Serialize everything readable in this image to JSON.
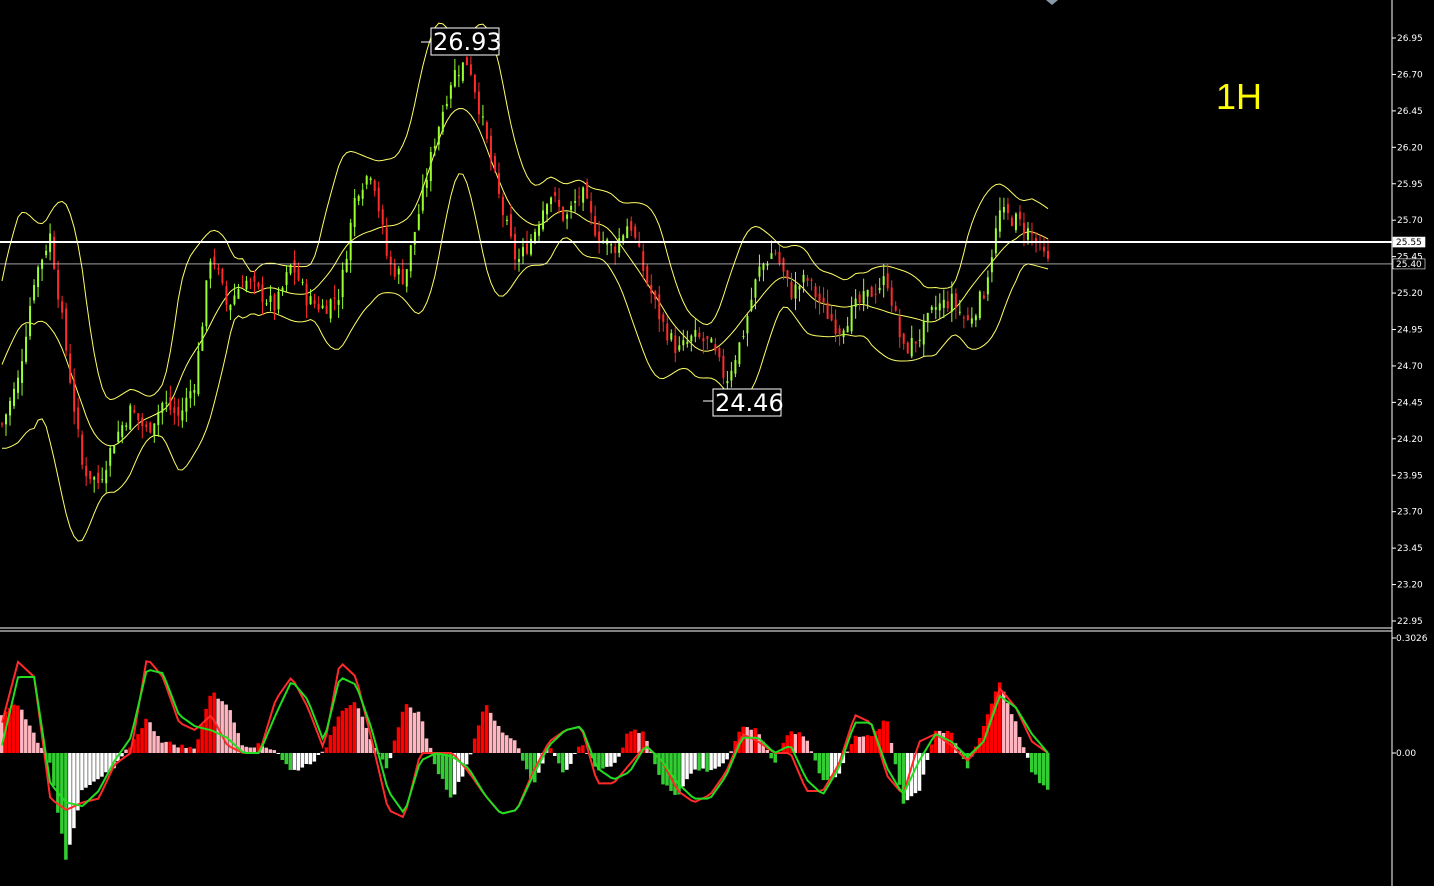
{
  "timeframe": "1H",
  "chart_data": [
    {
      "type": "candlestick",
      "title": "",
      "ylim": [
        22.9,
        27.1
      ],
      "y_ticks": [
        "26.95",
        "26.70",
        "26.45",
        "26.20",
        "25.95",
        "25.70",
        "25.45",
        "25.20",
        "24.95",
        "24.70",
        "24.45",
        "24.20",
        "23.95",
        "23.70",
        "23.45",
        "23.20",
        "22.95"
      ],
      "price_tags": [
        {
          "label": "25.55",
          "value": 25.55
        },
        {
          "label": "25.40",
          "value": 25.4
        }
      ],
      "annotations": [
        {
          "label": "26.93",
          "value": 26.93,
          "kind": "high"
        },
        {
          "label": "24.46",
          "value": 24.46,
          "kind": "low"
        }
      ],
      "colors": {
        "up": "#99ff33",
        "down": "#ff2a2a",
        "band": "#ffff66",
        "hline": "#ffffff"
      },
      "close_path": [
        24.3,
        24.6,
        25.3,
        25.6,
        24.8,
        24.0,
        23.9,
        24.2,
        24.4,
        24.25,
        24.45,
        24.35,
        24.6,
        25.5,
        25.1,
        25.3,
        25.2,
        25.1,
        25.4,
        25.15,
        25.1,
        25.2,
        25.9,
        26.05,
        25.4,
        25.3,
        25.8,
        26.3,
        26.7,
        26.8,
        26.3,
        25.8,
        25.4,
        25.6,
        25.9,
        25.7,
        25.9,
        25.6,
        25.5,
        25.7,
        25.3,
        25.0,
        24.8,
        24.9,
        24.85,
        24.6,
        24.9,
        25.35,
        25.5,
        25.2,
        25.3,
        25.1,
        24.95,
        25.1,
        25.2,
        25.3,
        24.8,
        24.9,
        25.1,
        25.15,
        25.0,
        25.2,
        25.75,
        25.7,
        25.6,
        25.4
      ]
    },
    {
      "type": "histogram+line",
      "title": "",
      "ylim": [
        -0.3026,
        0.3026
      ],
      "y_ticks": [
        "0.3026",
        "0.00"
      ],
      "colors": {
        "hist_up_strong": "#ff0000",
        "hist_up_weak": "#ffb6c1",
        "hist_down_strong": "#33cc33",
        "hist_down_weak": "#ffffff",
        "signal_fast": "#ff2a2a",
        "signal_slow": "#22dd22"
      },
      "histogram_path": [
        0.1,
        0.13,
        0.05,
        -0.03,
        -0.28,
        -0.1,
        -0.07,
        -0.04,
        0.02,
        0.09,
        0.03,
        0.02,
        0.01,
        0.16,
        0.13,
        0.02,
        0.02,
        0.01,
        -0.05,
        -0.03,
        0.0,
        0.11,
        0.14,
        0.02,
        -0.04,
        0.13,
        0.1,
        -0.04,
        -0.12,
        -0.02,
        0.13,
        0.06,
        0.03,
        -0.09,
        0.02,
        -0.06,
        0.03,
        -0.04,
        -0.04,
        0.06,
        0.05,
        -0.08,
        -0.11,
        -0.04,
        -0.05,
        -0.02,
        0.07,
        0.06,
        -0.03,
        0.06,
        0.04,
        -0.07,
        -0.06,
        0.05,
        0.04,
        0.09,
        -0.13,
        -0.1,
        0.06,
        0.05,
        -0.04,
        0.07,
        0.19,
        0.08,
        -0.05,
        -0.1
      ],
      "fast_path": [
        0.08,
        0.24,
        0.2,
        -0.12,
        -0.15,
        -0.13,
        -0.12,
        -0.03,
        0.0,
        0.25,
        0.2,
        0.08,
        0.06,
        0.1,
        0.02,
        0.0,
        0.0,
        0.14,
        0.2,
        0.12,
        0.01,
        0.24,
        0.2,
        0.03,
        -0.15,
        -0.17,
        0.0,
        0.0,
        0.0,
        -0.05,
        -0.11,
        -0.16,
        -0.15,
        -0.05,
        0.03,
        0.06,
        0.07,
        -0.08,
        -0.08,
        -0.03,
        0.02,
        -0.02,
        -0.1,
        -0.13,
        -0.11,
        -0.05,
        0.05,
        0.03,
        0.0,
        0.0,
        -0.1,
        -0.1,
        -0.03,
        0.1,
        0.08,
        -0.06,
        -0.11,
        0.03,
        0.05,
        0.02,
        -0.02,
        0.03,
        0.17,
        0.12,
        0.03,
        0.0
      ],
      "slow_path": [
        0.02,
        0.2,
        0.2,
        -0.08,
        -0.13,
        -0.14,
        -0.1,
        -0.02,
        0.04,
        0.22,
        0.21,
        0.1,
        0.07,
        0.06,
        0.04,
        0.0,
        0.0,
        0.1,
        0.19,
        0.14,
        0.03,
        0.2,
        0.18,
        0.06,
        -0.1,
        -0.16,
        -0.02,
        0.0,
        -0.01,
        -0.04,
        -0.11,
        -0.16,
        -0.15,
        -0.06,
        0.02,
        0.06,
        0.07,
        -0.04,
        -0.07,
        -0.05,
        0.02,
        -0.02,
        -0.08,
        -0.12,
        -0.12,
        -0.06,
        0.04,
        0.04,
        0.0,
        0.02,
        -0.07,
        -0.11,
        -0.04,
        0.08,
        0.08,
        -0.04,
        -0.11,
        -0.02,
        0.05,
        0.03,
        -0.01,
        0.03,
        0.15,
        0.12,
        0.05,
        0.0
      ]
    }
  ]
}
